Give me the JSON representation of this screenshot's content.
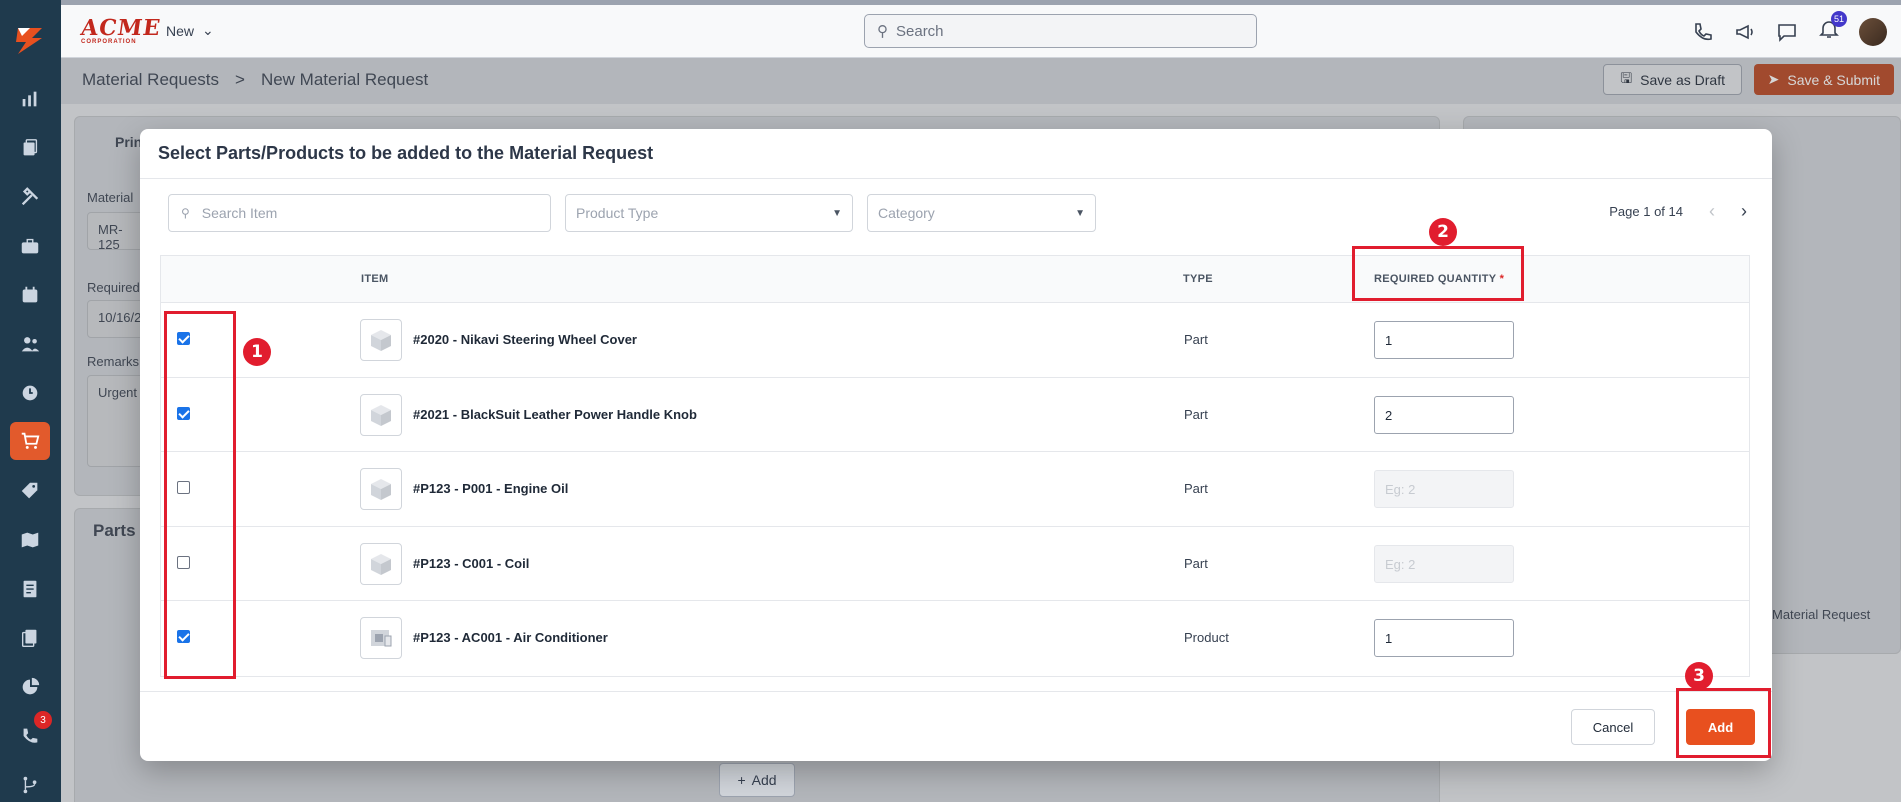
{
  "header": {
    "brand": "ACME",
    "brand_sub": "CORPORATION",
    "new_label": "New",
    "search_placeholder": "Search",
    "notif_count": "51"
  },
  "breadcrumb": {
    "parent": "Material Requests",
    "separator": ">",
    "current": "New Material Request"
  },
  "actions": {
    "draft": "Save as Draft",
    "submit": "Save & Submit"
  },
  "sidebar": {
    "badge": "3"
  },
  "background": {
    "card_title_partial": "Prin",
    "material_label": "Material",
    "material_value": "MR-125",
    "required_label": "Required",
    "required_value": "10/16/2",
    "remarks_label": "Remarks",
    "remarks_value": "Urgent",
    "parts_title": "Parts a",
    "right_text": "Material Request",
    "add_label": "Add"
  },
  "modal": {
    "title": "Select Parts/Products to be added to the Material Request",
    "search_placeholder": "Search Item",
    "product_type_placeholder": "Product Type",
    "category_placeholder": "Category",
    "pager": "Page 1 of 14",
    "columns": {
      "item": "ITEM",
      "type": "TYPE",
      "qty": "REQUIRED QUANTITY",
      "required_mark": "*"
    },
    "rows": [
      {
        "name": "#2020 - Nikavi Steering Wheel Cover",
        "type": "Part",
        "qty": "1",
        "placeholder": "",
        "checked": true
      },
      {
        "name": "#2021 - BlackSuit Leather Power Handle Knob",
        "type": "Part",
        "qty": "2",
        "placeholder": "",
        "checked": true
      },
      {
        "name": "#P123 - P001 - Engine Oil",
        "type": "Part",
        "qty": "",
        "placeholder": "Eg: 2",
        "checked": false
      },
      {
        "name": "#P123 - C001 - Coil",
        "type": "Part",
        "qty": "",
        "placeholder": "Eg: 2",
        "checked": false
      },
      {
        "name": "#P123 - AC001 - Air Conditioner",
        "type": "Product",
        "qty": "1",
        "placeholder": "",
        "checked": true
      }
    ],
    "cancel": "Cancel",
    "add": "Add"
  },
  "annotations": [
    "1",
    "2",
    "3"
  ],
  "colors": {
    "accent": "#e8501f",
    "sidebar": "#1f3a4d",
    "annotation": "#e11d2e",
    "checkbox": "#1a73e8"
  }
}
